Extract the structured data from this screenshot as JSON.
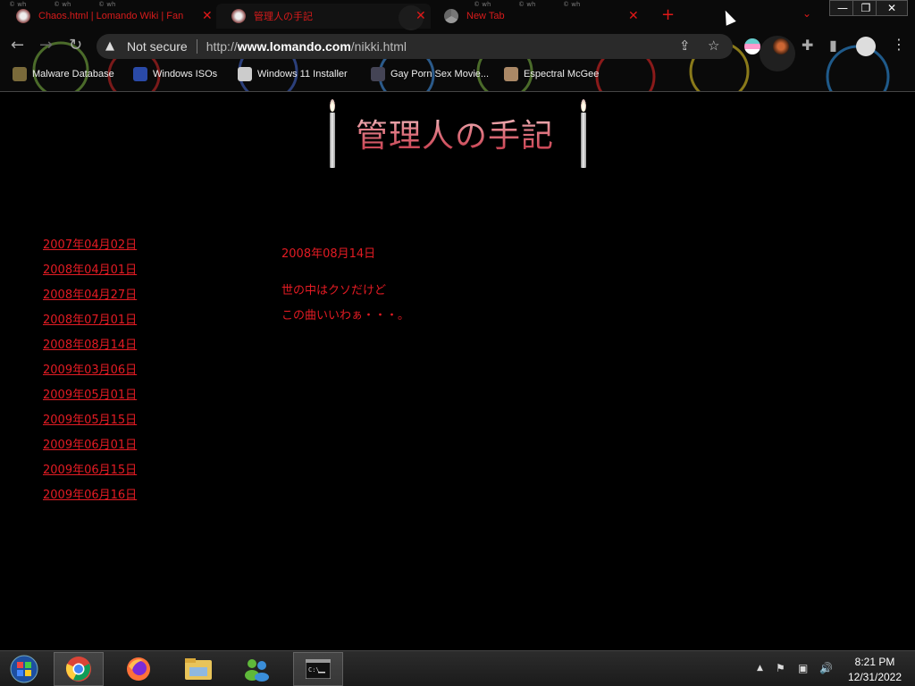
{
  "browser": {
    "tabs": [
      {
        "title": "Chaos.html | Lomando Wiki | Fan",
        "close": "✕"
      },
      {
        "title": "管理人の手記",
        "close": "✕"
      },
      {
        "title": "New Tab",
        "close": "✕"
      }
    ],
    "new_tab": "+",
    "tab_search": "⌄",
    "window": {
      "min": "—",
      "max": "❐",
      "close": "✕"
    },
    "watermark": "© wh",
    "nav": {
      "back": "←",
      "forward": "→",
      "reload": "↻"
    },
    "address": {
      "security": "Not secure",
      "url_prefix": "http://",
      "url_host": "www.lomando.com",
      "url_path": "/nikki.html"
    },
    "bookmarks": [
      {
        "label": "Malware Database"
      },
      {
        "label": "Windows ISOs"
      },
      {
        "label": "Windows 11 Installer"
      },
      {
        "label": "Gay Porn Sex Movie..."
      },
      {
        "label": "Espectral McGee"
      }
    ]
  },
  "page": {
    "banner_title": "管理人の手記",
    "dates": [
      "2007年04月02日",
      "2008年04月01日",
      "2008年04月27日",
      "2008年07月01日",
      "2008年08月14日",
      "2009年03月06日",
      "2009年05月01日",
      "2009年05月15日",
      "2009年06月01日",
      "2009年06月15日",
      "2009年06月16日"
    ],
    "entry": {
      "date": "2008年08月14日",
      "lines": [
        "世の中はクソだけど",
        "この曲いいわぁ・・・。"
      ]
    }
  },
  "taskbar": {
    "clock_time": "8:21 PM",
    "clock_date": "12/31/2022",
    "tray_overflow": "▲"
  },
  "colors": {
    "link_red": "#e31b23",
    "page_bg": "#000000"
  }
}
